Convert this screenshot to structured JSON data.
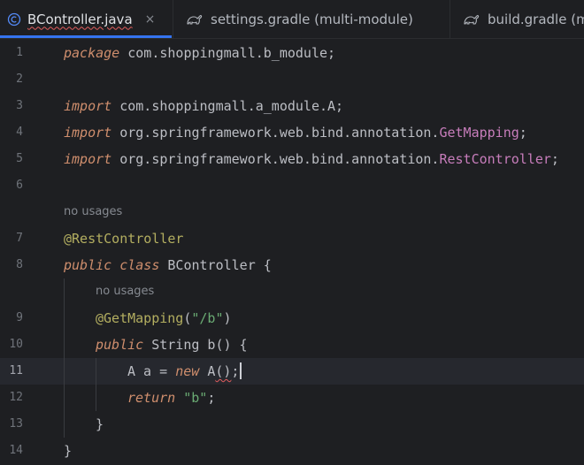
{
  "tabs": [
    {
      "label": "BController.java",
      "icon": "java-class-icon",
      "close": "×"
    },
    {
      "label": "settings.gradle (multi-module)",
      "icon": "gradle-icon"
    },
    {
      "label": "build.gradle (m",
      "icon": "gradle-icon"
    }
  ],
  "colors": {
    "background": "#1e1f22",
    "keyword": "#cf8e6d",
    "annotation": "#b3ae60",
    "string": "#6aab73",
    "imported_class": "#c77dbb",
    "accent": "#3574f0",
    "error": "#e25d5d"
  },
  "editor": {
    "line_numbers": [
      "1",
      "2",
      "3",
      "4",
      "5",
      "6",
      "7",
      "8",
      "9",
      "10",
      "11",
      "12",
      "13",
      "14"
    ],
    "current_line": "11",
    "hint_text": "no usages",
    "code": {
      "l1_kw": "package",
      "l1_rest": " com.shoppingmall.b_module;",
      "l3_kw": "import",
      "l3_rest": " com.shoppingmall.a_module.A;",
      "l4_kw": "import",
      "l4_pkg": " org.springframework.web.bind.annotation.",
      "l4_cls": "GetMapping",
      "l4_semi": ";",
      "l5_kw": "import",
      "l5_pkg": " org.springframework.web.bind.annotation.",
      "l5_cls": "RestController",
      "l5_semi": ";",
      "l7_ann": "@RestController",
      "l8_kw1": "public",
      "l8_kw2": "class",
      "l8_rest": " BController {",
      "l9_ann": "@GetMapping",
      "l9_open": "(",
      "l9_str": "\"/b\"",
      "l9_close": ")",
      "l10_kw": "public",
      "l10_rest": " String b() {",
      "l11_pre": "A a = ",
      "l11_kw": "new",
      "l11_space": " ",
      "l11_cls": "A",
      "l11_paren": "()",
      "l11_semi": ";",
      "l12_kw": "return",
      "l12_space": " ",
      "l12_str": "\"b\"",
      "l12_semi": ";",
      "l13": "}",
      "l14": "}"
    }
  }
}
